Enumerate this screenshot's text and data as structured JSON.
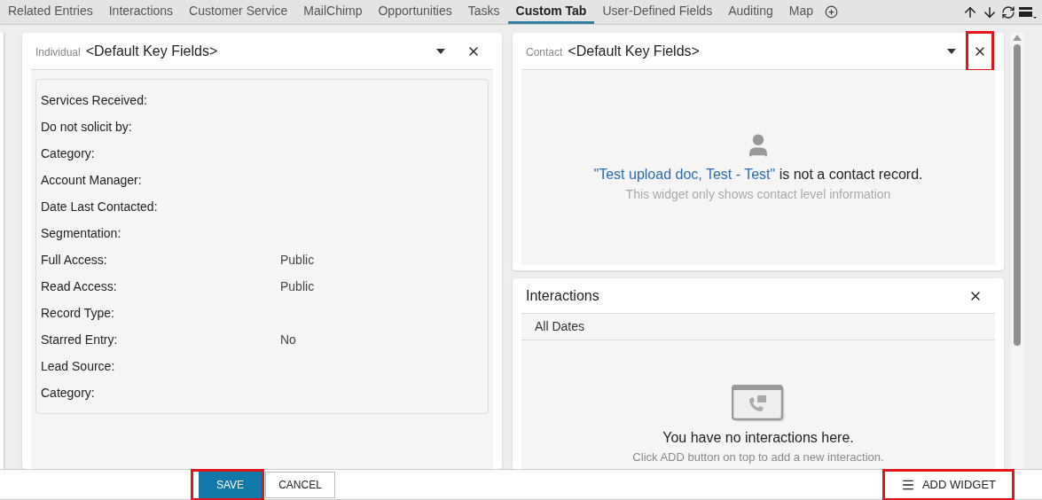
{
  "tabs": [
    {
      "label": "Related Entries",
      "selected": false
    },
    {
      "label": "Interactions",
      "selected": false
    },
    {
      "label": "Customer Service",
      "selected": false
    },
    {
      "label": "MailChimp",
      "selected": false
    },
    {
      "label": "Opportunities",
      "selected": false
    },
    {
      "label": "Tasks",
      "selected": false
    },
    {
      "label": "Custom Tab",
      "selected": true
    },
    {
      "label": "User-Defined Fields",
      "selected": false
    },
    {
      "label": "Auditing",
      "selected": false
    },
    {
      "label": "Map",
      "selected": false
    }
  ],
  "individual_widget": {
    "type_label": "Individual",
    "title": "<Default Key Fields>",
    "fields": [
      {
        "label": "Services Received:"
      },
      {
        "label": "Do not solicit by:"
      },
      {
        "label": "Category:"
      },
      {
        "label": "Account Manager:"
      },
      {
        "label": "Date Last Contacted:"
      },
      {
        "label": "Segmentation:"
      },
      {
        "label": "Full Access:",
        "value": "Public"
      },
      {
        "label": "Read Access:",
        "value": "Public"
      },
      {
        "label": "Record Type:"
      },
      {
        "label": "Starred Entry:",
        "value": "No"
      },
      {
        "label": "Lead Source:"
      },
      {
        "label": "Category:"
      }
    ]
  },
  "contact_widget": {
    "type_label": "Contact",
    "title": "<Default Key Fields>",
    "close_highlighted": true,
    "record_link": "\"Test upload doc, Test - Test\"",
    "message": "is not a contact record.",
    "note": "This widget only shows contact level information"
  },
  "interactions_widget": {
    "title": "Interactions",
    "filter": "All Dates",
    "empty_message": "You have no interactions here.",
    "empty_hint": "Click ADD button on top to add a new interaction."
  },
  "footer": {
    "save": {
      "label": "SAVE",
      "highlighted": true
    },
    "cancel": {
      "label": "CANCEL",
      "highlighted": false
    },
    "add_widget": {
      "label": "ADD WIDGET",
      "highlighted": true
    }
  }
}
